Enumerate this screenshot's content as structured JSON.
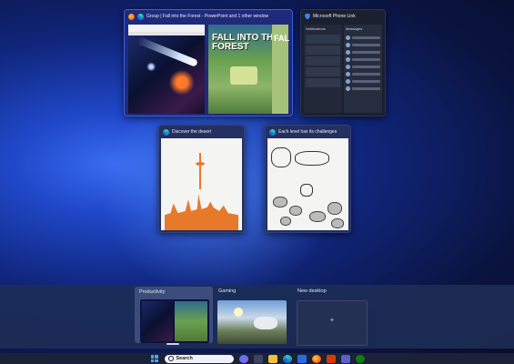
{
  "windows": [
    {
      "title": "Group | Fall into the Forest - PowerPoint and 1 other window",
      "forest_title": "FALL INTO THE FOREST",
      "forest_side": "FAL"
    },
    {
      "title": "Microsoft Phone Link",
      "right_header": "Messages",
      "left_header": "Notifications"
    },
    {
      "title": "Discover the desert"
    },
    {
      "title": "Each level has its challenges"
    }
  ],
  "desktops": [
    {
      "label": "Productivity"
    },
    {
      "label": "Gaming"
    },
    {
      "label": "New desktop",
      "add_symbol": "+"
    }
  ],
  "taskbar": {
    "search_label": "Search",
    "icons": [
      "start-icon",
      "search-icon",
      "copilot-icon",
      "task-view-icon",
      "file-explorer-icon",
      "edge-icon",
      "store-icon",
      "firefox-icon",
      "office-icon",
      "teams-icon",
      "xbox-icon"
    ]
  },
  "colors": {
    "accent": "#3a5ee0",
    "background": "#10257a"
  }
}
